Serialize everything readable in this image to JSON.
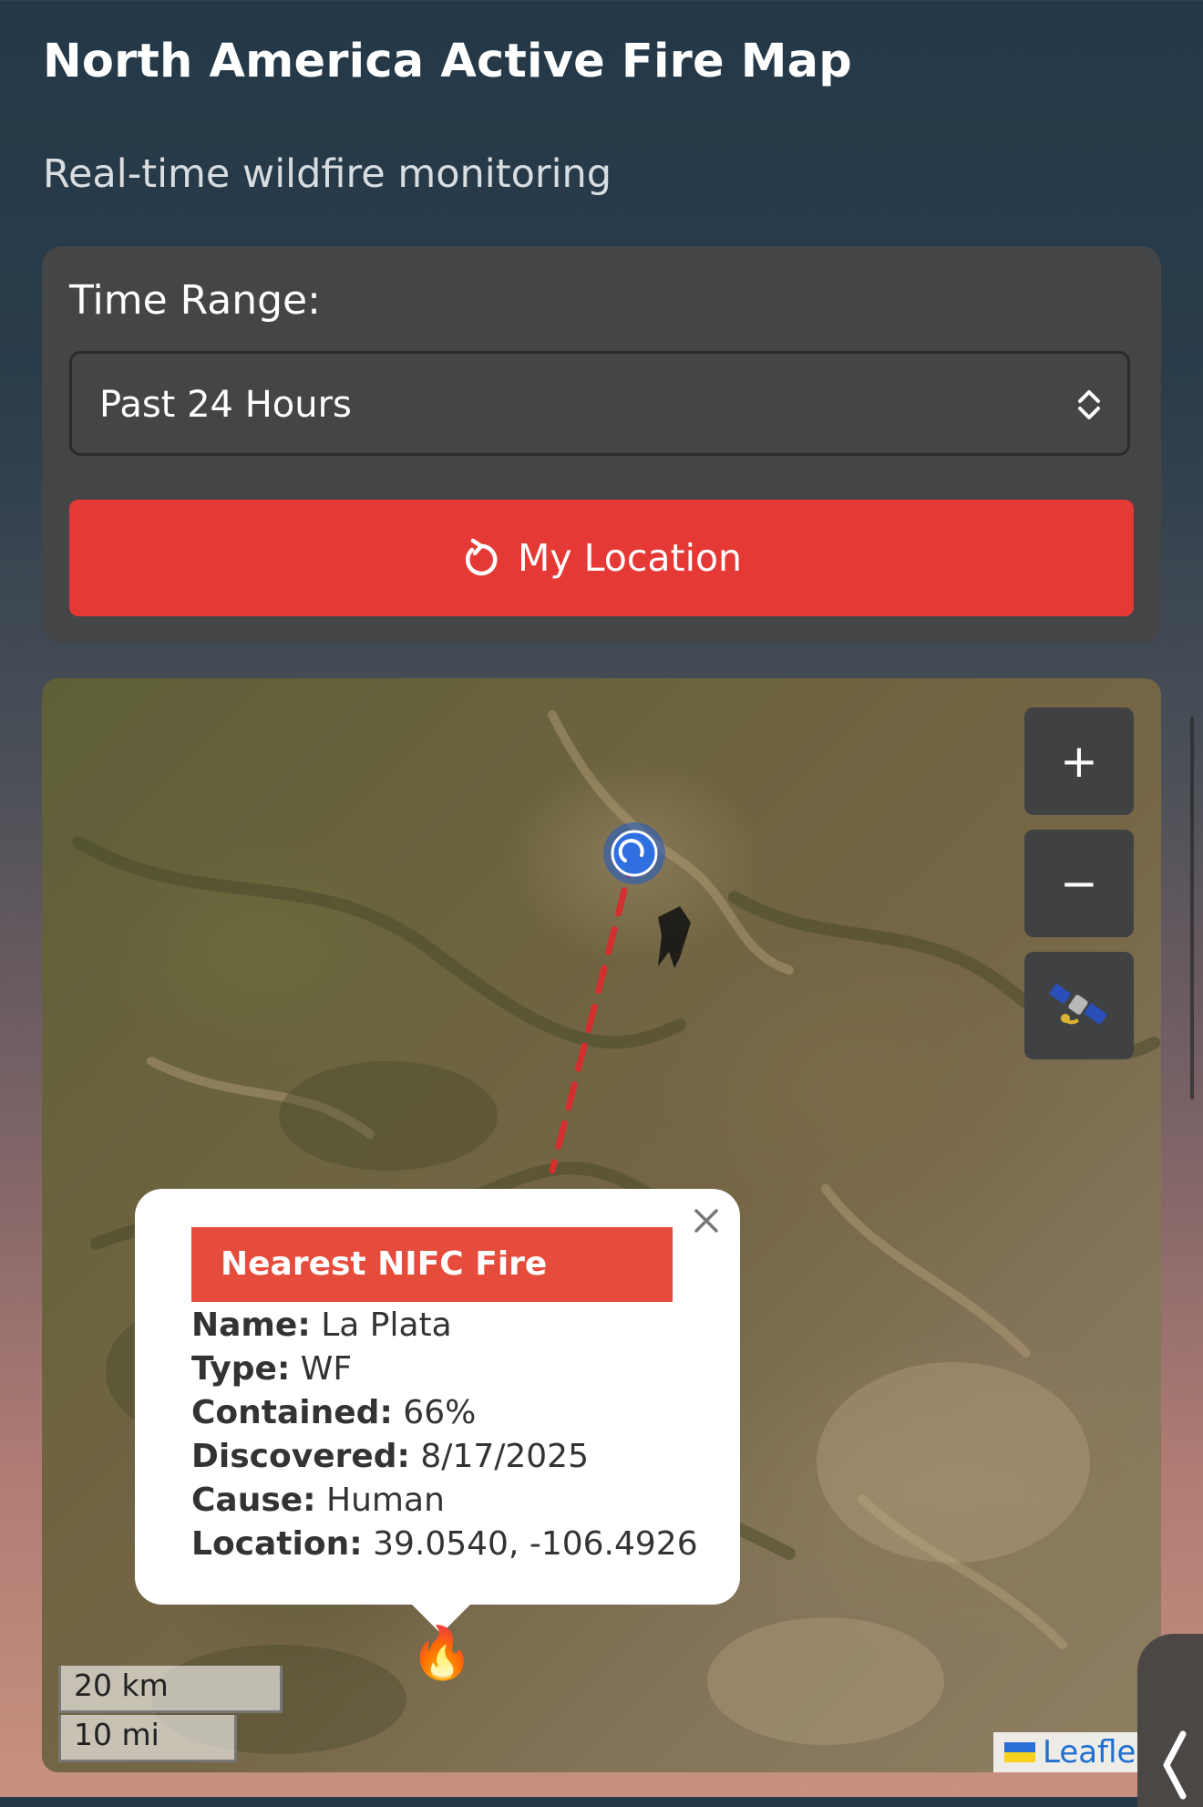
{
  "header": {
    "title": "North America Active Fire Map",
    "subtitle": "Real-time wildfire monitoring"
  },
  "controls": {
    "time_range_label": "Time Range:",
    "time_range_selected": "Past 24 Hours",
    "my_location_label": "My Location",
    "accent_color": "#e53935"
  },
  "map": {
    "zoom_in_label": "+",
    "zoom_out_label": "−",
    "layer_toggle_icon": "satellite-icon",
    "scale_km": "20 km",
    "scale_mi": "10 mi",
    "attribution": "Leafle",
    "popup": {
      "title": "Nearest NIFC Fire",
      "rows": [
        {
          "label": "Name:",
          "value": "La Plata"
        },
        {
          "label": "Type:",
          "value": "WF"
        },
        {
          "label": "Contained:",
          "value": "66%"
        },
        {
          "label": "Discovered:",
          "value": "8/17/2025"
        },
        {
          "label": "Cause:",
          "value": "Human"
        },
        {
          "label": "Location:",
          "value": "39.0540, -106.4926"
        }
      ]
    },
    "markers": {
      "user_location_icon": "user-location-icon",
      "fire_icon": "fire-icon",
      "fire_glyph": "🔥"
    }
  }
}
